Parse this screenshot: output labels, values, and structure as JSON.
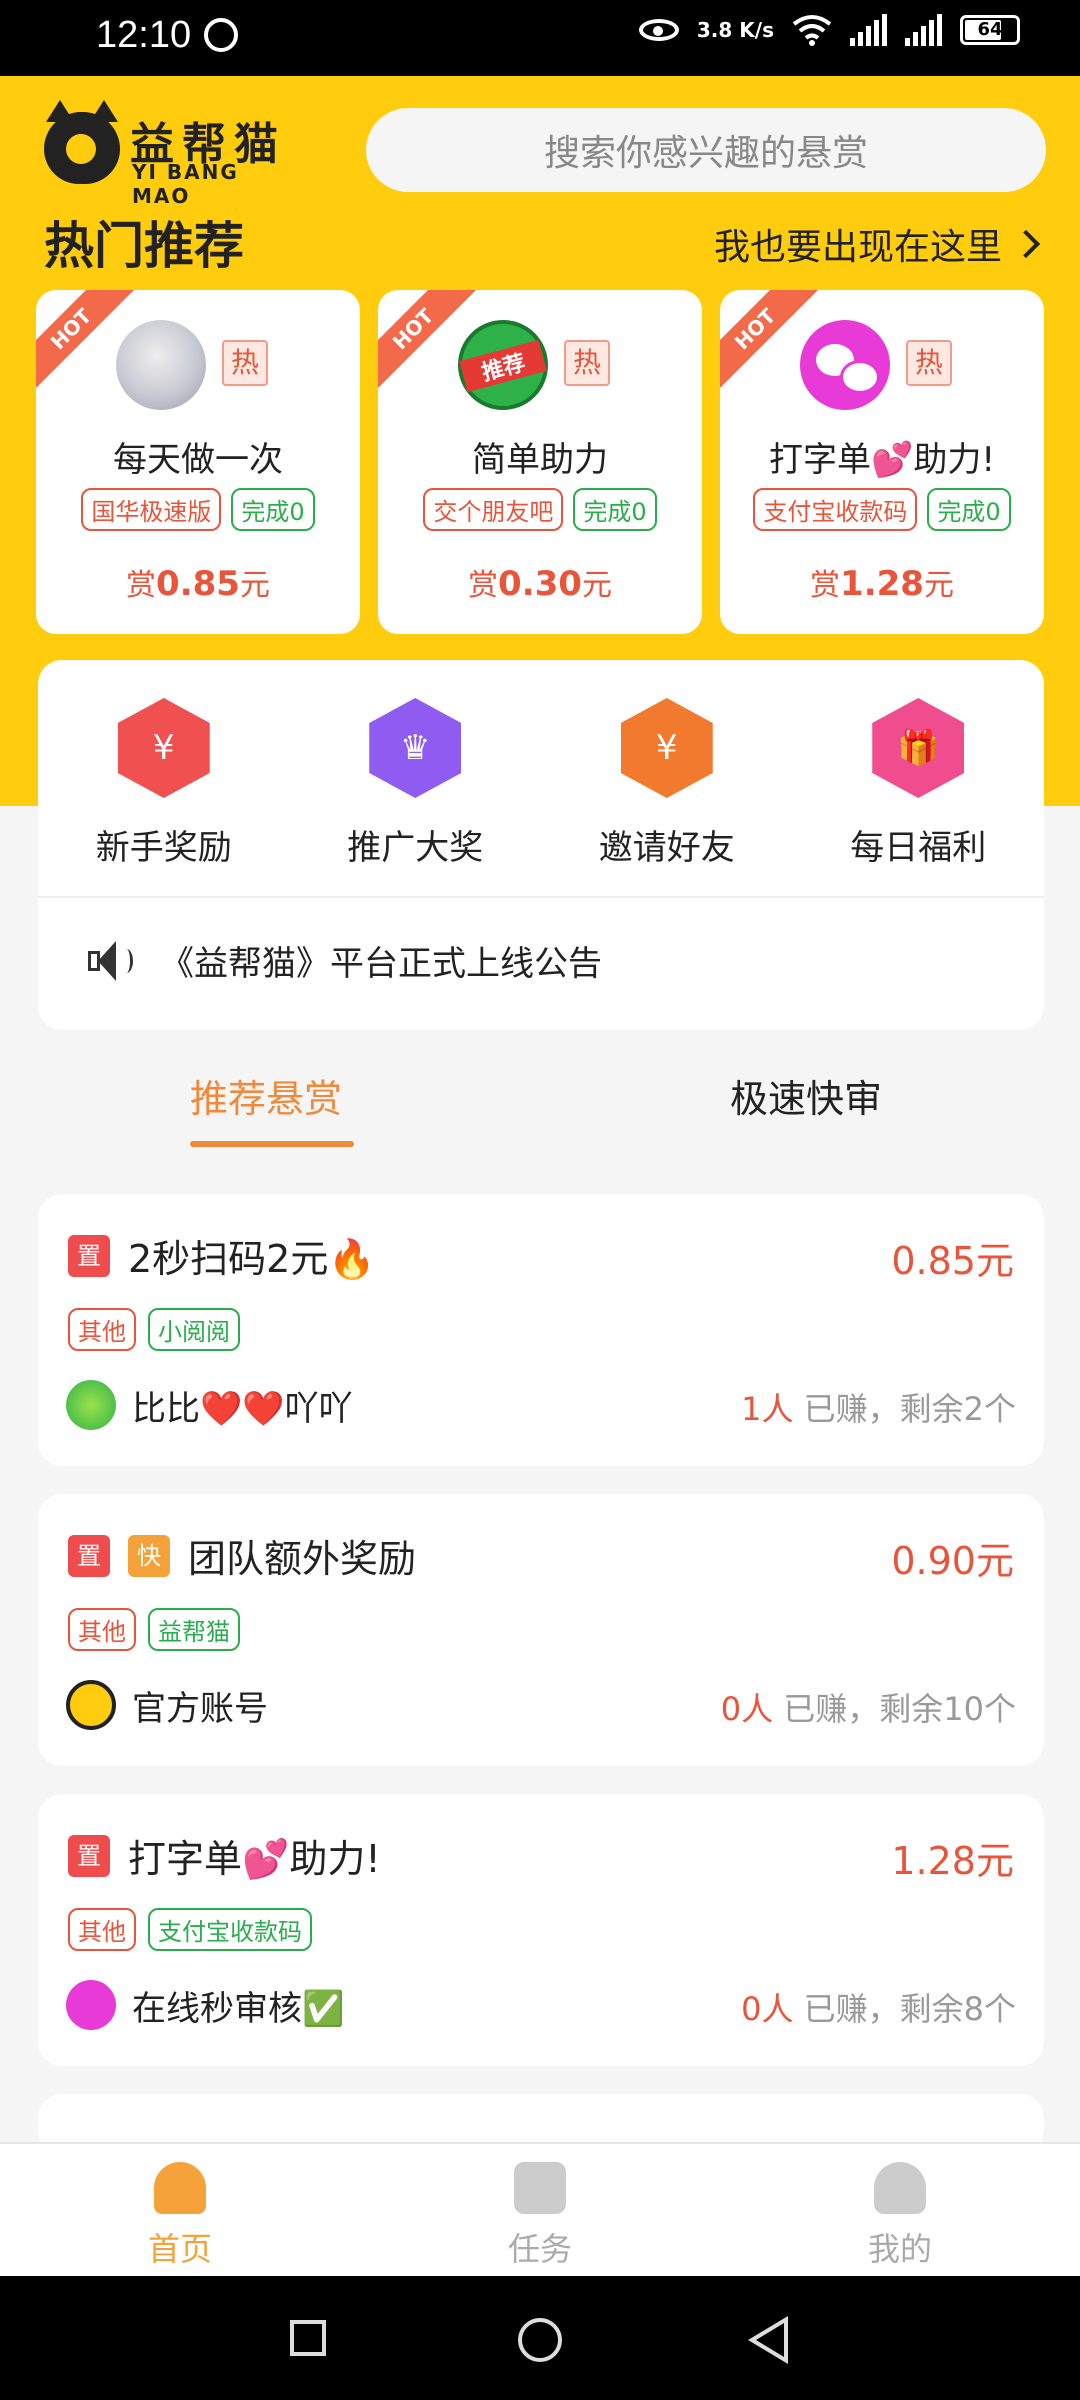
{
  "status_bar": {
    "time": "12:10",
    "net_speed": "3.8 K/s",
    "battery": "64"
  },
  "header": {
    "logo_cn": "益帮猫",
    "logo_en": "YI BANG MAO",
    "search_placeholder": "搜索你感兴趣的悬赏"
  },
  "hot": {
    "title": "热门推荐",
    "more_link": "我也要出现在这里",
    "ribbon": "HOT",
    "hot_badge": "热",
    "cards": [
      {
        "name": "每天做一次",
        "tag": "国华极速版",
        "done": "完成0",
        "reward_prefix": "赏",
        "reward": "0.85",
        "reward_unit": "元"
      },
      {
        "name": "简单助力",
        "tag": "交个朋友吧",
        "done": "完成0",
        "reward_prefix": "赏",
        "reward": "0.30",
        "reward_unit": "元"
      },
      {
        "name": "打字单💕助力!",
        "tag": "支付宝收款码",
        "done": "完成0",
        "reward_prefix": "赏",
        "reward": "1.28",
        "reward_unit": "元"
      }
    ]
  },
  "menu": {
    "items": [
      {
        "label": "新手奖励",
        "icon": "red-envelope-icon",
        "color": "#f0504f"
      },
      {
        "label": "推广大奖",
        "icon": "crown-icon",
        "color": "#8e5cf0"
      },
      {
        "label": "邀请好友",
        "icon": "money-bag-icon",
        "color": "#f27a2e"
      },
      {
        "label": "每日福利",
        "icon": "gift-icon",
        "color": "#f04d8e"
      }
    ],
    "notice": "《益帮猫》平台正式上线公告"
  },
  "tabs": [
    {
      "label": "推荐悬赏",
      "active": true
    },
    {
      "label": "极速快审",
      "active": false
    }
  ],
  "tasks": [
    {
      "badges": [
        "置"
      ],
      "title": "2秒扫码2元🔥",
      "price": "0.85元",
      "tags": [
        "其他",
        "小阅阅"
      ],
      "user": "比比❤️❤️吖吖",
      "earned": "1人",
      "remain": " 已赚，剩余2个"
    },
    {
      "badges": [
        "置",
        "快"
      ],
      "title": "团队额外奖励",
      "price": "0.90元",
      "tags": [
        "其他",
        "益帮猫"
      ],
      "user": "官方账号",
      "earned": "0人",
      "remain": " 已赚，剩余10个"
    },
    {
      "badges": [
        "置"
      ],
      "title": "打字单💕助力!",
      "price": "1.28元",
      "tags": [
        "其他",
        "支付宝收款码"
      ],
      "user": "在线秒审核✅",
      "earned": "0人",
      "remain": " 已赚，剩余8个"
    }
  ],
  "bottom_nav": [
    {
      "label": "首页",
      "icon": "home-icon",
      "active": true
    },
    {
      "label": "任务",
      "icon": "task-list-icon",
      "active": false
    },
    {
      "label": "我的",
      "icon": "profile-icon",
      "active": false
    }
  ],
  "colors": {
    "brand_yellow": "#ffcc0e",
    "accent_orange": "#f08a3a",
    "price_red": "#e8553a",
    "tag_green": "#2aae4d"
  }
}
